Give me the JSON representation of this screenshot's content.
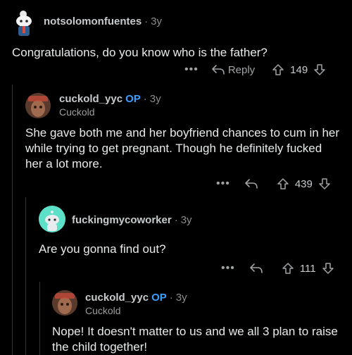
{
  "comments": [
    {
      "username": "notsolomonfuentes",
      "op": "",
      "age": "3y",
      "flair": "",
      "body": "Congratulations, do you know who is the father?",
      "reply_label": "Reply",
      "score": "149"
    },
    {
      "username": "cuckold_yyc",
      "op": "OP",
      "age": "3y",
      "flair": "Cuckold",
      "body": "She gave both me and her boyfriend chances to cum in her while trying to get pregnant. Though he definitely fucked her a lot more.",
      "score": "439"
    },
    {
      "username": "fuckingmycoworker",
      "op": "",
      "age": "3y",
      "flair": "",
      "body": "Are you gonna find out?",
      "score": "111"
    },
    {
      "username": "cuckold_yyc",
      "op": "OP",
      "age": "3y",
      "flair": "Cuckold",
      "body": "Nope! It doesn't matter to us and we all 3 plan to raise the child together!",
      "score": ""
    }
  ],
  "dot": "·",
  "ellipsis": "•••",
  "colors": {
    "background": "#000000",
    "op_blue": "#3aa0ff",
    "thread_line": "#343536",
    "snoo_teal": "#5ce0c8"
  },
  "icons": [
    "snoo-avatar-icon",
    "profile-avatar-icon",
    "reply-arrow-icon",
    "upvote-icon",
    "downvote-icon",
    "more-options-icon"
  ]
}
